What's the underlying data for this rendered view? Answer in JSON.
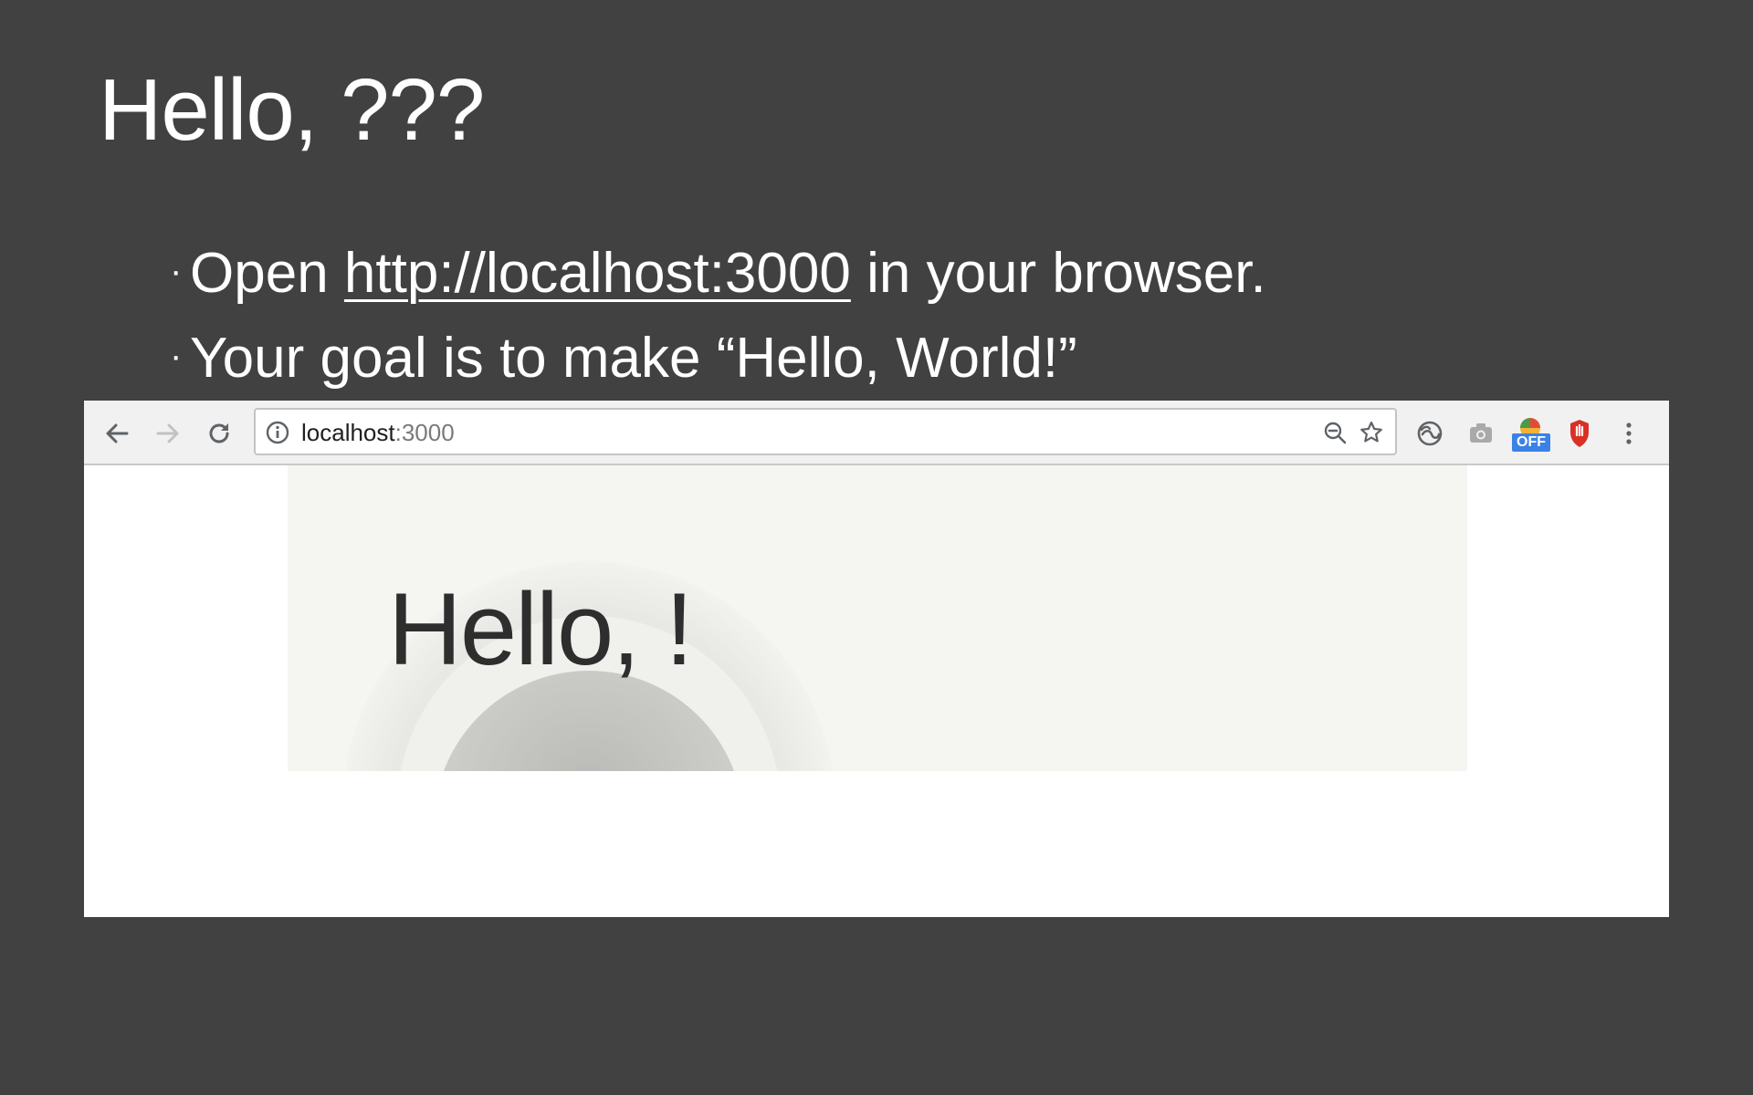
{
  "slide": {
    "title": "Hello, ???",
    "bullets": [
      {
        "prefix": "Open ",
        "link": "http://localhost:3000",
        "suffix": " in your browser."
      },
      {
        "text": "Your goal is to make “Hello, World!”"
      }
    ]
  },
  "browser": {
    "url_host": "localhost",
    "url_port": ":3000",
    "extension_badge": "OFF",
    "page": {
      "heading": "Hello, !"
    }
  },
  "colors": {
    "slide_background": "#414141",
    "toolbar_background": "#f1f1f1",
    "hero_background": "#f5f5f2",
    "extension_blue": "#3b82e6",
    "extension_red": "#d93025"
  }
}
